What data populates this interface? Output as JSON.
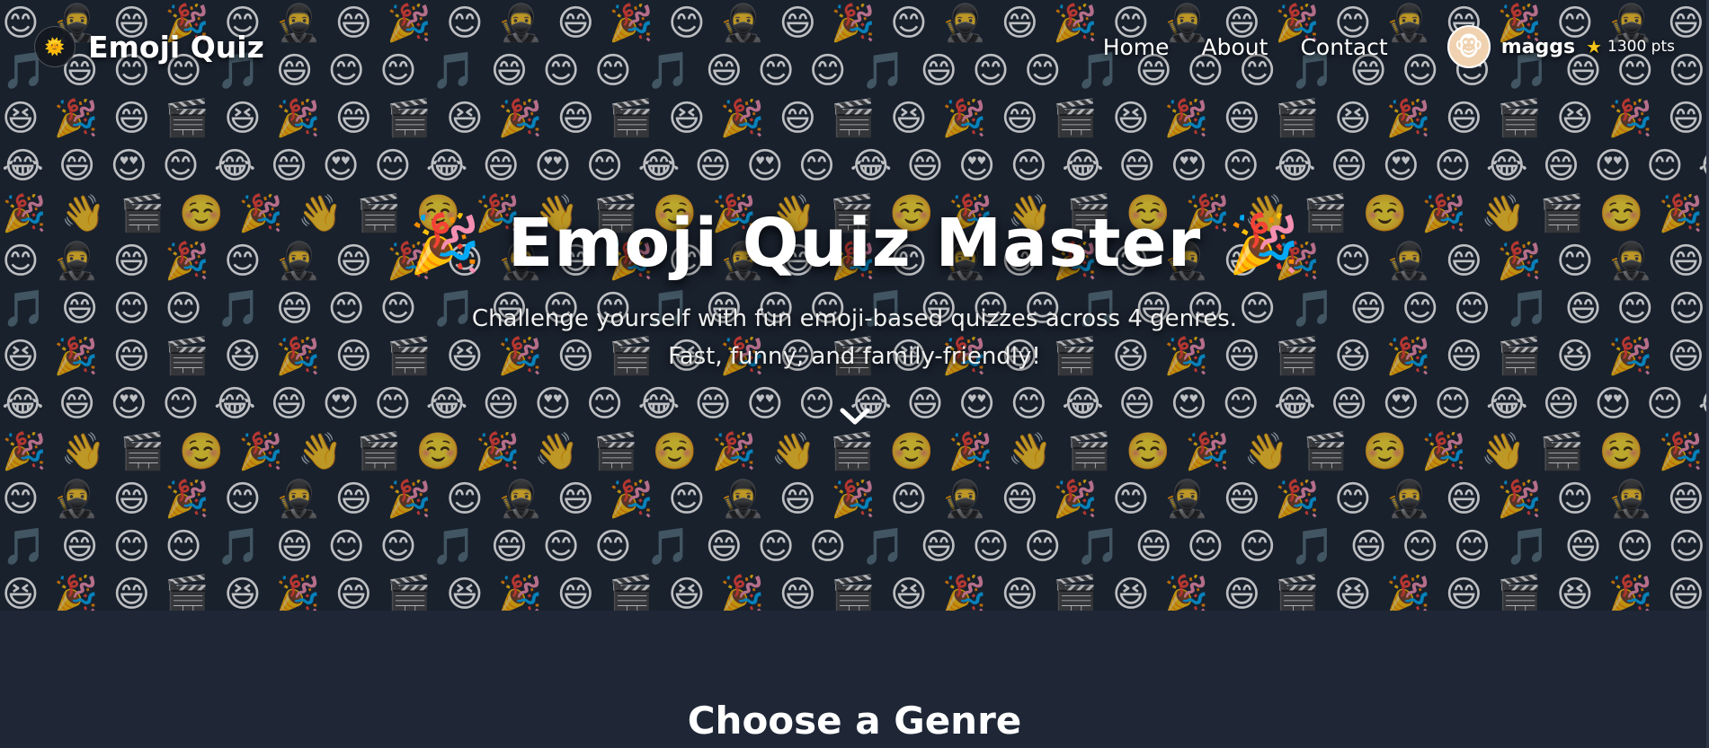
{
  "nav": {
    "brand_logo_emoji": "🌞",
    "brand_name": "Emoji Quiz",
    "links": [
      "Home",
      "About",
      "Contact"
    ],
    "user": {
      "avatar_emoji": "🐵",
      "name": "maggs",
      "points_icon": "star-icon",
      "points": "1300 pts"
    }
  },
  "hero": {
    "title": "Emoji Quiz Master",
    "title_icon": "🎉",
    "subtitle_line1": "Challenge yourself with fun emoji-based quizzes across 4 genres.",
    "subtitle_line2": "Fast, funny, and family-friendly!",
    "scroll_icon": "chevron-down-icon",
    "background_rows": [
      "😊🥷😄🎉😊🥷😄🎉😊🥷😄🎉😊🥷😄🎉😊🥷😄🎉😊🥷😄🎉😊🥷😄🎉😊🥷😄🎉😊",
      "🎵😄😊😊🎵😄😊😊🎵😄😊😊🎵😄😊😊🎵😄😊😊🎵😄😊😊🎵😄😊😊🎵😄😊😊🎵",
      "😆🎉😄🎬😆🎉😄🎬😆🎉😄🎬😆🎉😄🎬😆🎉😄🎬😆🎉😄🎬😆🎉😄🎬😆🎉😄🎬😆",
      "😂😄😍😊😂😄😍😊😂😄😍😊😂😄😍😊😂😄😍😊😂😄😍😊😂😄😍😊😂😄😍😊😂",
      "🎉👋🎬☺️🎉👋🎬☺️🎉👋🎬☺️🎉👋🎬☺️🎉👋🎬☺️🎉👋🎬☺️🎉👋🎬☺️🎉👋🎬☺️🎉",
      "😊🥷😄🎉😊🥷😄🎉😊🥷😄🎉😊🥷😄🎉😊🥷😄🎉😊🥷😄🎉😊🥷😄🎉😊🥷😄🎉😊",
      "🎵😄😊😊🎵😄😊😊🎵😄😊😊🎵😄😊😊🎵😄😊😊🎵😄😊😊🎵😄😊😊🎵😄😊😊🎵",
      "😆🎉😄🎬😆🎉😄🎬😆🎉😄🎬😆🎉😄🎬😆🎉😄🎬😆🎉😄🎬😆🎉😄🎬😆🎉😄🎬😆",
      "😂😄😍😊😂😄😍😊😂😄😍😊😂😄😍😊😂😄😍😊😂😄😍😊😂😄😍😊😂😄😍😊😂",
      "🎉👋🎬☺️🎉👋🎬☺️🎉👋🎬☺️🎉👋🎬☺️🎉👋🎬☺️🎉👋🎬☺️🎉👋🎬☺️🎉👋🎬☺️🎉",
      "😊🥷😄🎉😊🥷😄🎉😊🥷😄🎉😊🥷😄🎉😊🥷😄🎉😊🥷😄🎉😊🥷😄🎉😊🥷😄🎉😊",
      "🎵😄😊😊🎵😄😊😊🎵😄😊😊🎵😄😊😊🎵😄😊😊🎵😄😊😊🎵😄😊😊🎵😄😊😊🎵",
      "😆🎉😄🎬😆🎉😄🎬😆🎉😄🎬😆🎉😄🎬😆🎉😄🎬😆🎉😄🎬😆🎉😄🎬😆🎉😄🎬😆"
    ]
  },
  "genres": {
    "title": "Choose a Genre"
  },
  "colors": {
    "page_bg": "#1f2737",
    "hero_bg": "#1d2431",
    "star": "#f5c518",
    "text": "#ffffff"
  }
}
